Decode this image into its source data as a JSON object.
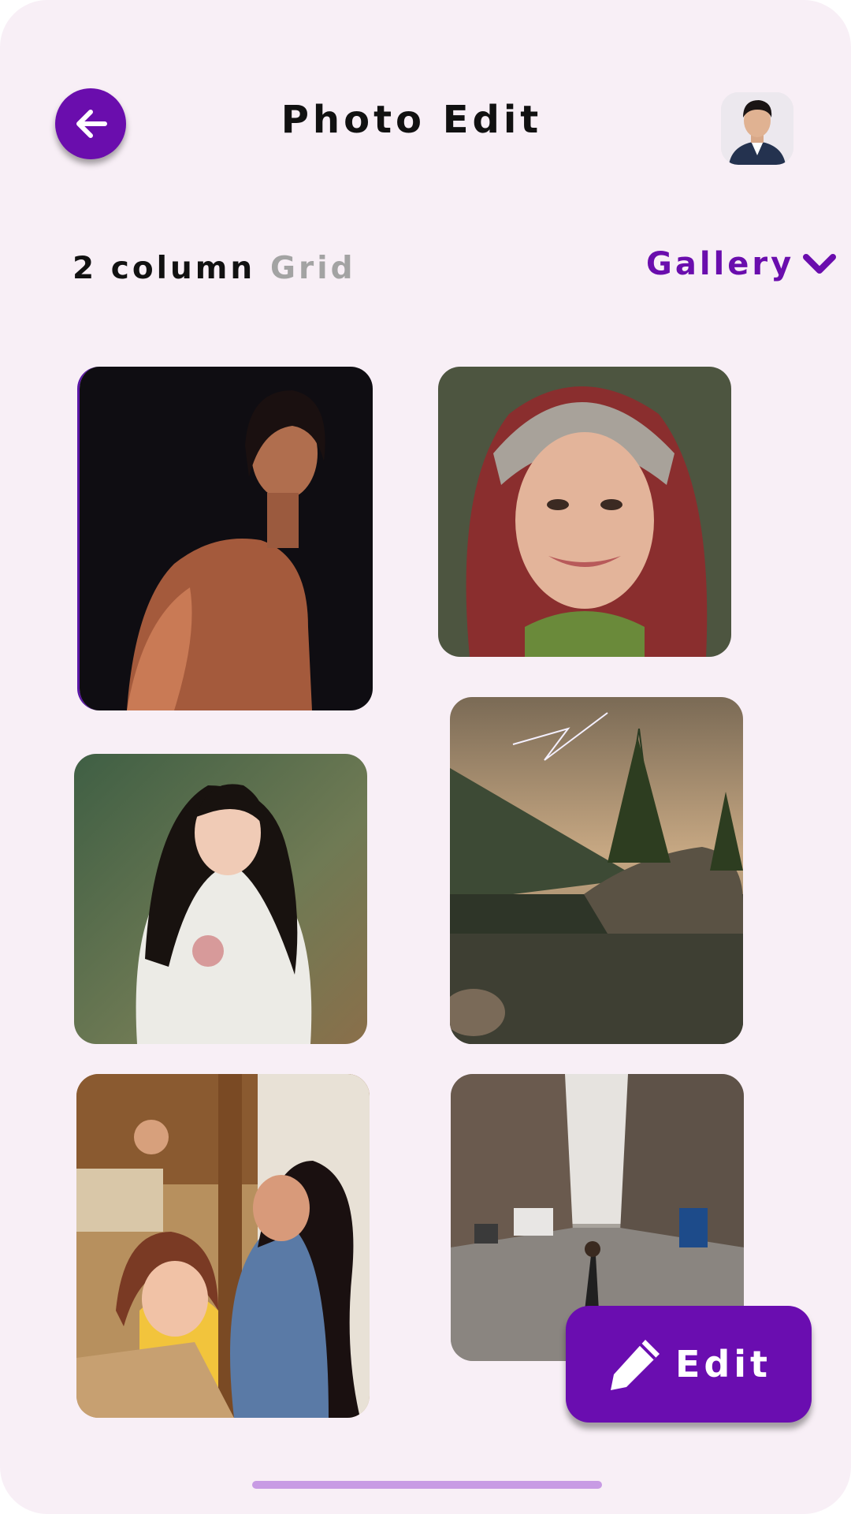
{
  "header": {
    "title": "Photo Edit",
    "back_icon": "arrow-left-icon",
    "avatar": "user-avatar"
  },
  "filters": {
    "column_label": "2 column",
    "grid_label": "Grid",
    "gallery_label": "Gallery",
    "gallery_icon": "chevron-down-icon"
  },
  "photos": [
    {
      "subject": "shirtless man with long hair"
    },
    {
      "subject": "woman in ornate headdress"
    },
    {
      "subject": "girl in white dress"
    },
    {
      "subject": "lake with tree and lightning"
    },
    {
      "subject": "mother and daughter with boxes"
    },
    {
      "subject": "city street with buildings"
    }
  ],
  "fab": {
    "label": "Edit",
    "icon": "pencil-icon"
  },
  "colors": {
    "accent": "#6a0dad",
    "background": "#f8eff6",
    "home_indicator": "#c89be4"
  }
}
